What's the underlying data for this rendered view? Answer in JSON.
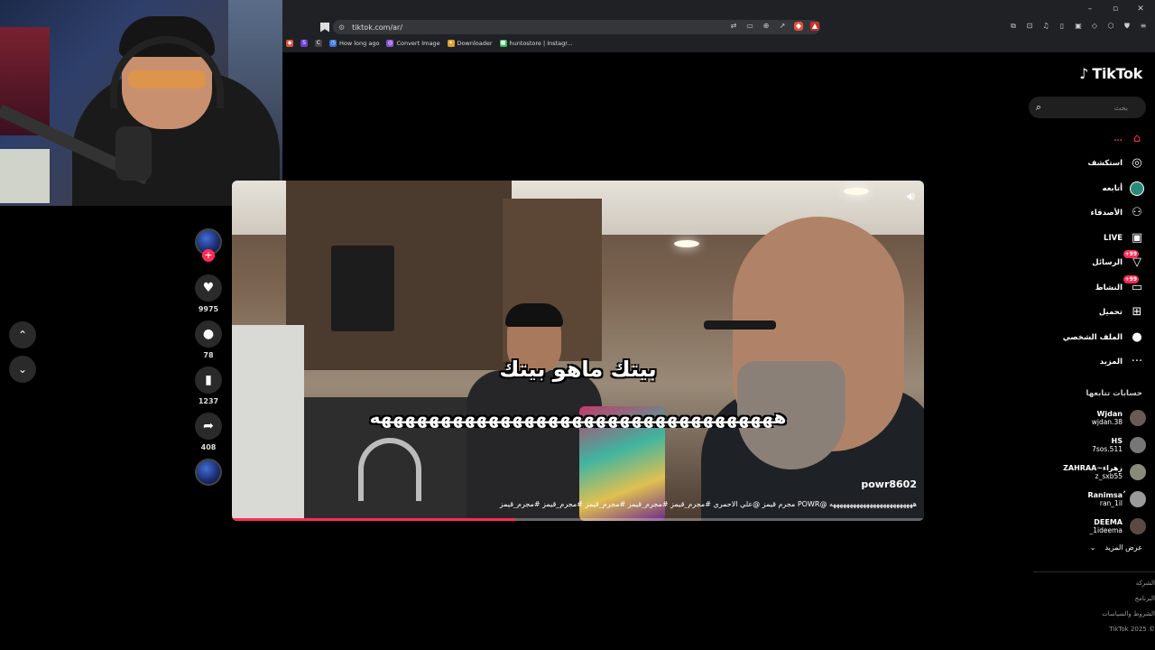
{
  "browser": {
    "url": "tiktok.com/ar/",
    "bookmarks": [
      {
        "label": "How long ago"
      },
      {
        "label": "Convert Image"
      },
      {
        "label": "Downloader"
      },
      {
        "label": "huntostore | Instagr..."
      }
    ],
    "window_controls": [
      "–",
      "▫",
      "✕"
    ]
  },
  "brand": {
    "name": "TikTok",
    "accent": "#fe2c55"
  },
  "search": {
    "placeholder": "بحث"
  },
  "nav": [
    {
      "label": "...",
      "icon": "home-icon",
      "active": true
    },
    {
      "label": "استكشف",
      "icon": "compass-icon"
    },
    {
      "label": "أتابعه",
      "icon": "following-icon"
    },
    {
      "label": "الأصدقاء",
      "icon": "friends-icon"
    },
    {
      "label": "LIVE",
      "icon": "live-icon"
    },
    {
      "label": "الرسائل",
      "icon": "messages-icon",
      "badge": "99+"
    },
    {
      "label": "النشاط",
      "icon": "activity-icon",
      "badge": "99+"
    },
    {
      "label": "تحميل",
      "icon": "upload-icon"
    },
    {
      "label": "الملف الشخصي",
      "icon": "profile-icon"
    },
    {
      "label": "المزيد",
      "icon": "more-icon"
    }
  ],
  "following_section": {
    "title": "حسابات تتابعها",
    "accounts": [
      {
        "name": "Wjdan",
        "handle": "wjdan.38"
      },
      {
        "name": "HS",
        "handle": "7sos.511"
      },
      {
        "name": "ZAHRAA~زهراء",
        "handle": "z_sxb55"
      },
      {
        "name": "Ranimsaُ",
        "handle": "ran_1il"
      },
      {
        "name": "DEEMA",
        "handle": "_1ideema"
      }
    ],
    "see_more": "عرض المزيد"
  },
  "footer": [
    "الشركة",
    "البرنامج",
    "الشروط والسياسات",
    "© 2025 TikTok"
  ],
  "actions": {
    "likes": "9975",
    "comments": "78",
    "saves": "1237",
    "shares": "408"
  },
  "video": {
    "caption_line1": "بيتك ماهو بيتك",
    "caption_line2": "ههههههههههههههههههههههههههههههههههه",
    "author": "powr8602",
    "description": "هههههههههههههههههههههههههه @POWR مجرم قيمز @علي الاحمري #مجرم_قيمز #مجرم_قيمز #مجرم_قيمز #مجرم_قيمز #مجرم_قيمز",
    "progress": 0.41
  }
}
